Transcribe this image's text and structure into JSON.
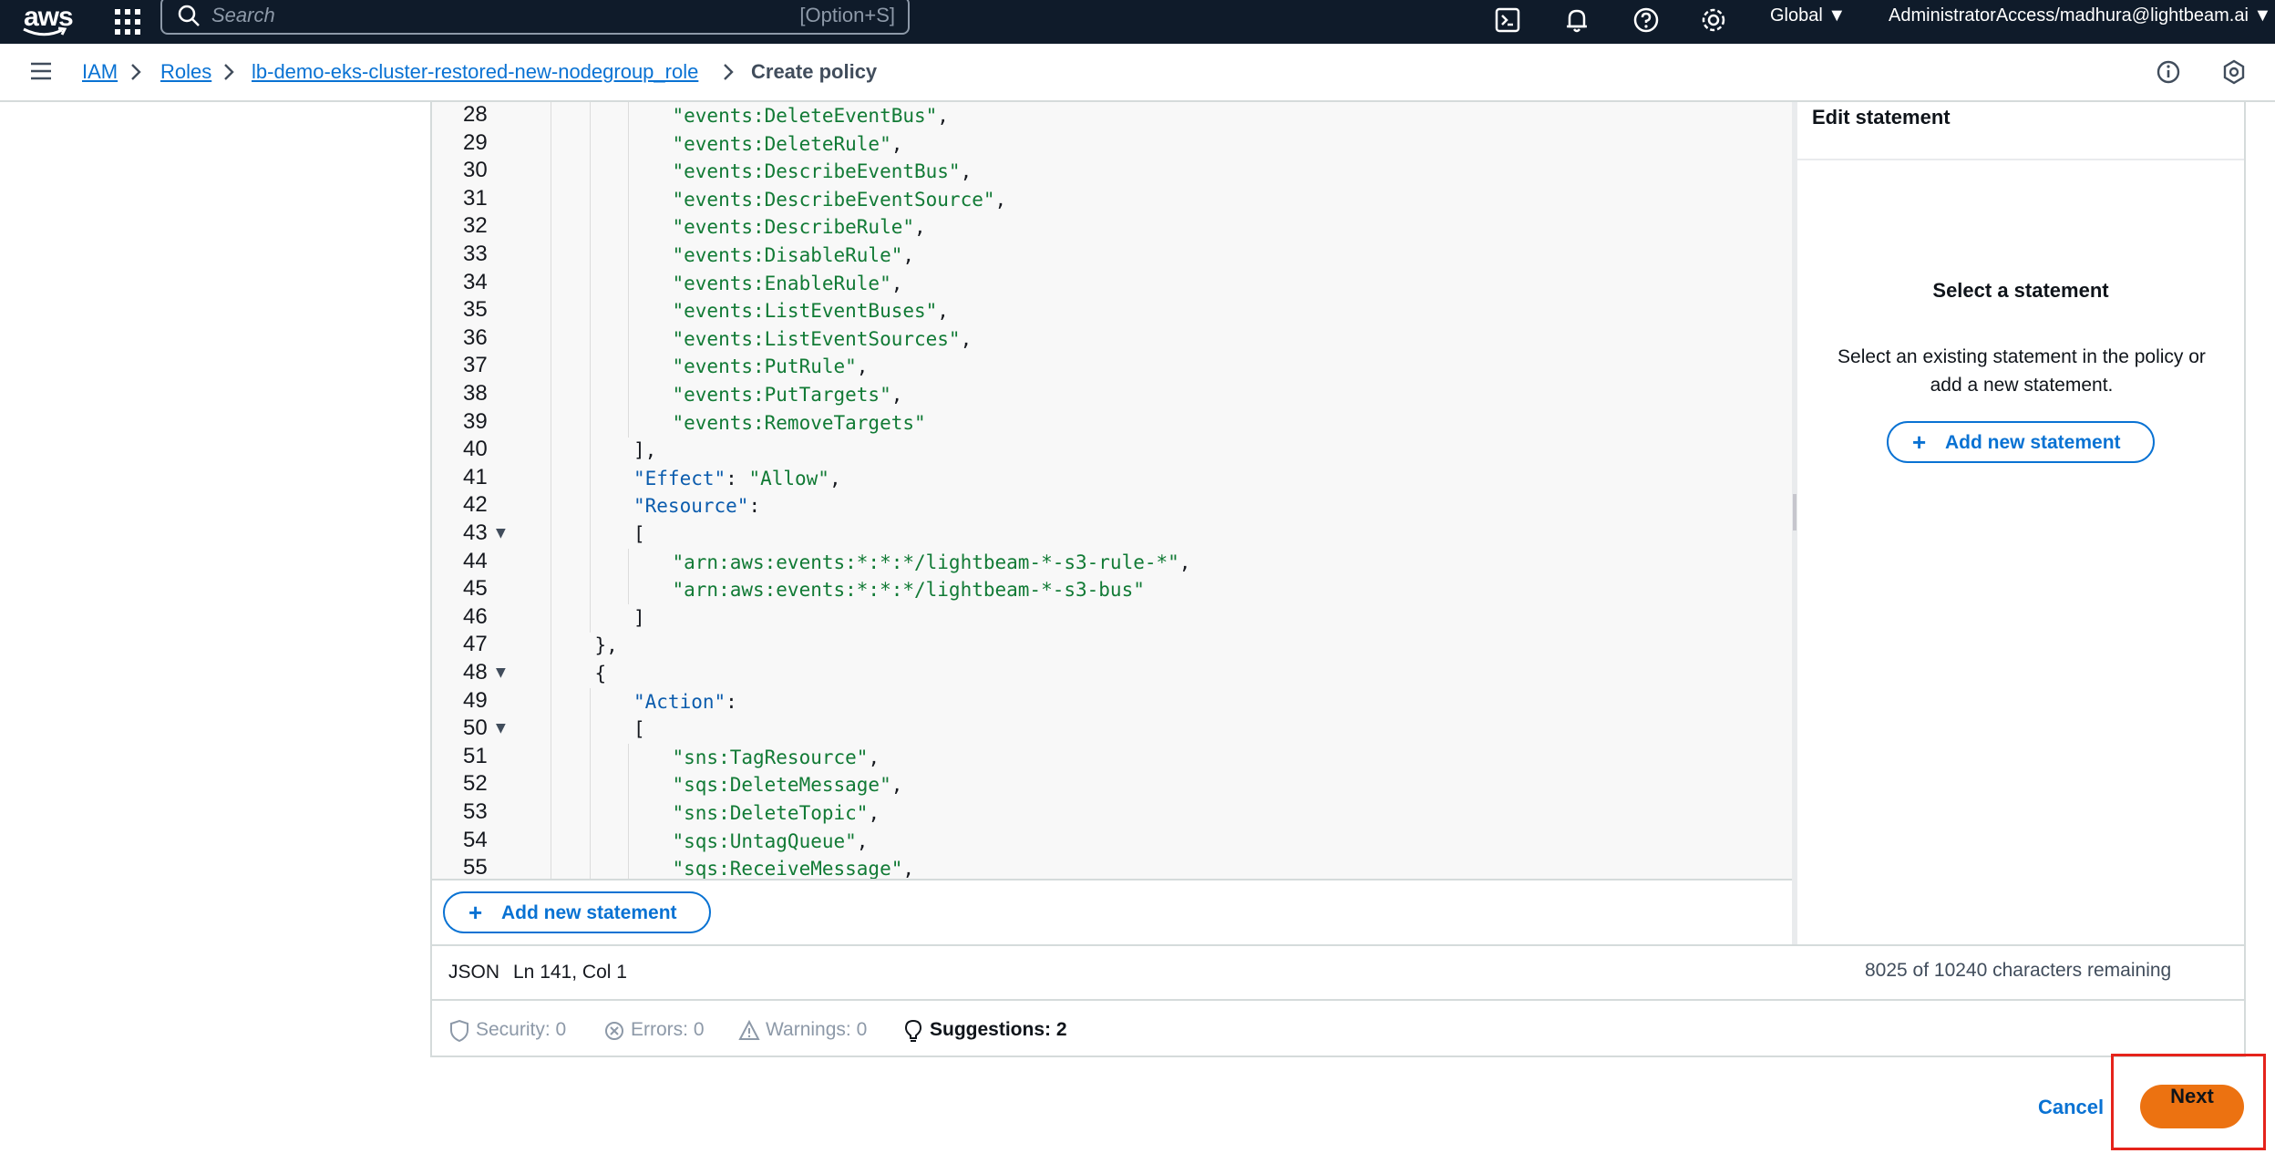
{
  "topnav": {
    "logo_text": "aws",
    "search_placeholder": "Search",
    "search_shortcut": "[Option+S]",
    "region": "Global ▼",
    "account": "AdministratorAccess/madhura@lightbeam.ai ▼",
    "icons": [
      "apps-grid-icon",
      "search-icon",
      "cloudshell-icon",
      "bell-icon",
      "help-icon",
      "gear-icon"
    ]
  },
  "breadcrumb": {
    "items": [
      "IAM",
      "Roles",
      "lb-demo-eks-cluster-restored-new-nodegroup_role"
    ],
    "current": "Create policy"
  },
  "editor": {
    "lines": [
      {
        "n": "28",
        "indent": 3,
        "fold": false,
        "tokens": [
          {
            "t": "\"events:DeleteEventBus\"",
            "c": "str"
          },
          {
            "t": ",",
            "c": "punc"
          }
        ]
      },
      {
        "n": "29",
        "indent": 3,
        "fold": false,
        "tokens": [
          {
            "t": "\"events:DeleteRule\"",
            "c": "str"
          },
          {
            "t": ",",
            "c": "punc"
          }
        ]
      },
      {
        "n": "30",
        "indent": 3,
        "fold": false,
        "tokens": [
          {
            "t": "\"events:DescribeEventBus\"",
            "c": "str"
          },
          {
            "t": ",",
            "c": "punc"
          }
        ]
      },
      {
        "n": "31",
        "indent": 3,
        "fold": false,
        "tokens": [
          {
            "t": "\"events:DescribeEventSource\"",
            "c": "str"
          },
          {
            "t": ",",
            "c": "punc"
          }
        ]
      },
      {
        "n": "32",
        "indent": 3,
        "fold": false,
        "tokens": [
          {
            "t": "\"events:DescribeRule\"",
            "c": "str"
          },
          {
            "t": ",",
            "c": "punc"
          }
        ]
      },
      {
        "n": "33",
        "indent": 3,
        "fold": false,
        "tokens": [
          {
            "t": "\"events:DisableRule\"",
            "c": "str"
          },
          {
            "t": ",",
            "c": "punc"
          }
        ]
      },
      {
        "n": "34",
        "indent": 3,
        "fold": false,
        "tokens": [
          {
            "t": "\"events:EnableRule\"",
            "c": "str"
          },
          {
            "t": ",",
            "c": "punc"
          }
        ]
      },
      {
        "n": "35",
        "indent": 3,
        "fold": false,
        "tokens": [
          {
            "t": "\"events:ListEventBuses\"",
            "c": "str"
          },
          {
            "t": ",",
            "c": "punc"
          }
        ]
      },
      {
        "n": "36",
        "indent": 3,
        "fold": false,
        "tokens": [
          {
            "t": "\"events:ListEventSources\"",
            "c": "str"
          },
          {
            "t": ",",
            "c": "punc"
          }
        ]
      },
      {
        "n": "37",
        "indent": 3,
        "fold": false,
        "tokens": [
          {
            "t": "\"events:PutRule\"",
            "c": "str"
          },
          {
            "t": ",",
            "c": "punc"
          }
        ]
      },
      {
        "n": "38",
        "indent": 3,
        "fold": false,
        "tokens": [
          {
            "t": "\"events:PutTargets\"",
            "c": "str"
          },
          {
            "t": ",",
            "c": "punc"
          }
        ]
      },
      {
        "n": "39",
        "indent": 3,
        "fold": false,
        "tokens": [
          {
            "t": "\"events:RemoveTargets\"",
            "c": "str"
          }
        ]
      },
      {
        "n": "40",
        "indent": 2,
        "fold": false,
        "tokens": [
          {
            "t": "],",
            "c": "punc"
          }
        ]
      },
      {
        "n": "41",
        "indent": 2,
        "fold": false,
        "tokens": [
          {
            "t": "\"Effect\"",
            "c": "key"
          },
          {
            "t": ": ",
            "c": "punc"
          },
          {
            "t": "\"Allow\"",
            "c": "str"
          },
          {
            "t": ",",
            "c": "punc"
          }
        ]
      },
      {
        "n": "42",
        "indent": 2,
        "fold": false,
        "tokens": [
          {
            "t": "\"Resource\"",
            "c": "key"
          },
          {
            "t": ":",
            "c": "punc"
          }
        ]
      },
      {
        "n": "43",
        "indent": 2,
        "fold": true,
        "tokens": [
          {
            "t": "[",
            "c": "punc"
          }
        ]
      },
      {
        "n": "44",
        "indent": 3,
        "fold": false,
        "tokens": [
          {
            "t": "\"arn:aws:events:*:*:*/lightbeam-*-s3-rule-*\"",
            "c": "str"
          },
          {
            "t": ",",
            "c": "punc"
          }
        ]
      },
      {
        "n": "45",
        "indent": 3,
        "fold": false,
        "tokens": [
          {
            "t": "\"arn:aws:events:*:*:*/lightbeam-*-s3-bus\"",
            "c": "str"
          }
        ]
      },
      {
        "n": "46",
        "indent": 2,
        "fold": false,
        "tokens": [
          {
            "t": "]",
            "c": "punc"
          }
        ]
      },
      {
        "n": "47",
        "indent": 1,
        "fold": false,
        "tokens": [
          {
            "t": "},",
            "c": "punc"
          }
        ]
      },
      {
        "n": "48",
        "indent": 1,
        "fold": true,
        "tokens": [
          {
            "t": "{",
            "c": "punc"
          }
        ]
      },
      {
        "n": "49",
        "indent": 2,
        "fold": false,
        "tokens": [
          {
            "t": "\"Action\"",
            "c": "key"
          },
          {
            "t": ":",
            "c": "punc"
          }
        ]
      },
      {
        "n": "50",
        "indent": 2,
        "fold": true,
        "tokens": [
          {
            "t": "[",
            "c": "punc"
          }
        ]
      },
      {
        "n": "51",
        "indent": 3,
        "fold": false,
        "tokens": [
          {
            "t": "\"sns:TagResource\"",
            "c": "str"
          },
          {
            "t": ",",
            "c": "punc"
          }
        ]
      },
      {
        "n": "52",
        "indent": 3,
        "fold": false,
        "tokens": [
          {
            "t": "\"sqs:DeleteMessage\"",
            "c": "str"
          },
          {
            "t": ",",
            "c": "punc"
          }
        ]
      },
      {
        "n": "53",
        "indent": 3,
        "fold": false,
        "tokens": [
          {
            "t": "\"sns:DeleteTopic\"",
            "c": "str"
          },
          {
            "t": ",",
            "c": "punc"
          }
        ]
      },
      {
        "n": "54",
        "indent": 3,
        "fold": false,
        "tokens": [
          {
            "t": "\"sqs:UntagQueue\"",
            "c": "str"
          },
          {
            "t": ",",
            "c": "punc"
          }
        ]
      },
      {
        "n": "55",
        "indent": 3,
        "fold": false,
        "tokens": [
          {
            "t": "\"sqs:ReceiveMessage\"",
            "c": "str"
          },
          {
            "t": ",",
            "c": "punc"
          }
        ]
      }
    ],
    "add_statement_label": "Add new statement"
  },
  "statement_panel": {
    "title": "Edit statement",
    "empty_title": "Select a statement",
    "empty_desc": "Select an existing statement in the policy or add a new statement.",
    "add_statement_label": "Add new statement"
  },
  "status": {
    "language": "JSON",
    "position": "Ln 141, Col 1",
    "chars_remaining": "8025 of 10240 characters remaining",
    "security": "Security: 0",
    "errors": "Errors: 0",
    "warnings": "Warnings: 0",
    "suggestions": "Suggestions: 2"
  },
  "footer": {
    "cancel_label": "Cancel",
    "next_label": "Next"
  },
  "colors": {
    "nav_bg": "#0f1b2a",
    "link": "#0972d3",
    "primary_button": "#ec7211",
    "highlight_box": "#e5231b",
    "json_string": "#117a35",
    "json_key": "#0b5cad"
  }
}
